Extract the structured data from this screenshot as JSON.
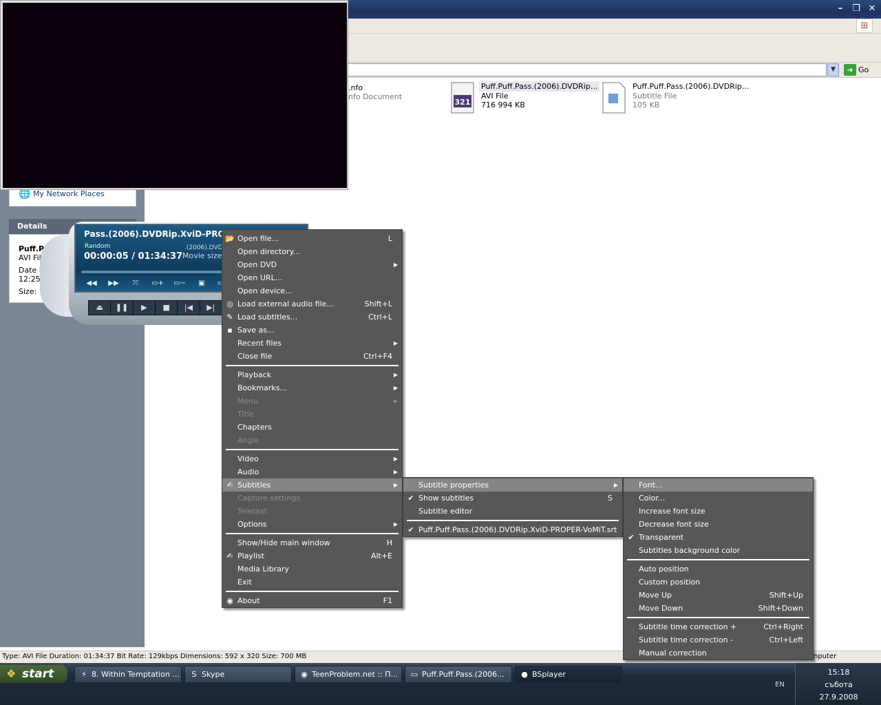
{
  "explorer": {
    "go_label": "Go",
    "network_places": "My Network Places",
    "details_header": "Details",
    "details_lines": [
      "Puff.P",
      "AVI File",
      "Date M",
      "12:25",
      "Size: 70("
    ],
    "files": [
      {
        "name": ".nfo",
        "type": "nfo Document",
        "size": ""
      },
      {
        "name": "Puff.Puff.Pass.(2006).DVDRip...",
        "type": "AVI File",
        "size": "716 994 KB"
      },
      {
        "name": "Puff.Puff.Pass.(2006).DVDRip...",
        "type": "Subtitle File",
        "size": "105 KB"
      }
    ],
    "status_text": "Type: AVI File Duration: 01:34:37 Bit Rate: 129kbps Dimensions: 592 x 320 Size: 700 MB",
    "status_right": "nputer"
  },
  "player": {
    "title": "Pass.(2006).DVDRip.XviD-PROPER-V",
    "mode": "Random",
    "time": "00:00:05 / 01:34:37",
    "file_short": ".(2006).DVDR",
    "movie_size": "Movie size:"
  },
  "menu_main": [
    {
      "label": "Open file...",
      "shortcut": "L",
      "icon": "folder-icon"
    },
    {
      "label": "Open directory...",
      "shortcut": ""
    },
    {
      "label": "Open DVD",
      "shortcut": "",
      "submenu": true
    },
    {
      "label": "Open URL...",
      "shortcut": ""
    },
    {
      "label": "Open device...",
      "shortcut": ""
    },
    {
      "label": "Load external audio file...",
      "shortcut": "Shift+L",
      "icon": "audio-disc-icon"
    },
    {
      "label": "Load subtitles...",
      "shortcut": "Ctrl+L",
      "icon": "subtitle-pen-icon"
    },
    {
      "label": "Save as...",
      "shortcut": "",
      "icon": "floppy-icon"
    },
    {
      "label": "Recent files",
      "shortcut": "",
      "submenu": true
    },
    {
      "label": "Close file",
      "shortcut": "Ctrl+F4"
    },
    {
      "sep": true
    },
    {
      "label": "Playback",
      "submenu": true
    },
    {
      "label": "Bookmarks...",
      "submenu": true
    },
    {
      "label": "Menu",
      "submenu": true,
      "disabled": true
    },
    {
      "label": "Title",
      "disabled": true
    },
    {
      "label": "Chapters"
    },
    {
      "label": "Angle",
      "disabled": true
    },
    {
      "sep": true
    },
    {
      "label": "Video",
      "submenu": true
    },
    {
      "label": "Audio",
      "submenu": true
    },
    {
      "label": "Subtitles",
      "submenu": true,
      "highlighted": true,
      "icon": "subtitles-icon"
    },
    {
      "label": "Capture settings",
      "disabled": true
    },
    {
      "label": "Teletext",
      "disabled": true
    },
    {
      "label": "Options",
      "submenu": true
    },
    {
      "sep": true
    },
    {
      "label": "Show/Hide main window",
      "shortcut": "H"
    },
    {
      "label": "Playlist",
      "shortcut": "Alt+E",
      "icon": "playlist-icon"
    },
    {
      "label": "Media Library"
    },
    {
      "label": "Exit"
    },
    {
      "sep": true
    },
    {
      "label": "About",
      "shortcut": "F1",
      "icon": "about-icon"
    }
  ],
  "menu_subtitles": [
    {
      "label": "Subtitle properties",
      "submenu": true,
      "highlighted": true
    },
    {
      "label": "Show subtitles",
      "shortcut": "S",
      "checked": true
    },
    {
      "label": "Subtitle editor"
    },
    {
      "sep": true
    },
    {
      "label": "Puff.Puff.Pass.(2006).DVDRip.XviD-PROPER-VoMiT.srt",
      "checked": true
    }
  ],
  "menu_props": [
    {
      "label": "Font...",
      "highlighted": true
    },
    {
      "label": "Color..."
    },
    {
      "label": "Increase font size"
    },
    {
      "label": "Decrease font size"
    },
    {
      "label": "Transparent",
      "checked": true
    },
    {
      "label": "Subtitles background color"
    },
    {
      "sep": true
    },
    {
      "label": "Auto position"
    },
    {
      "label": "Custom position"
    },
    {
      "label": "Move Up",
      "shortcut": "Shift+Up"
    },
    {
      "label": "Move Down",
      "shortcut": "Shift+Down"
    },
    {
      "sep": true
    },
    {
      "label": "Subtitle time correction +",
      "shortcut": "Ctrl+Right"
    },
    {
      "label": "Subtitle time correction -",
      "shortcut": "Ctrl+Left"
    },
    {
      "label": "Manual correction"
    }
  ],
  "taskbar": {
    "start": "start",
    "tasks": [
      {
        "label": "8. Within Temptation ...",
        "icon": "winamp-icon"
      },
      {
        "label": "Skype",
        "icon": "skype-icon"
      },
      {
        "label": "TeenProblem.net :: П...",
        "icon": "firefox-icon"
      },
      {
        "label": "Puff.Puff.Pass.(2006...",
        "icon": "folder-icon"
      },
      {
        "label": "BSplayer",
        "icon": "bsplayer-icon",
        "active": true
      }
    ],
    "lang": "EN",
    "time": "15:18",
    "day": "събота",
    "date": "27.9.2008"
  }
}
